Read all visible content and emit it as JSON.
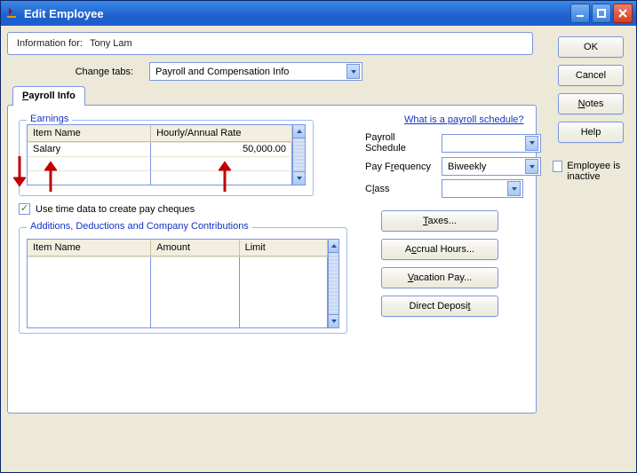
{
  "title": "Edit Employee",
  "info_label": "Information for:",
  "info_name": "Tony Lam",
  "change_tabs_label": "Change tabs:",
  "tab_selector_value": "Payroll and Compensation Info",
  "active_tab": "Payroll Info",
  "earnings": {
    "legend": "Earnings",
    "col_name": "Item Name",
    "col_rate": "Hourly/Annual Rate",
    "rows": [
      {
        "name": "Salary",
        "rate": "50,000.00"
      }
    ]
  },
  "use_time_data_label": "Use time data to create pay cheques",
  "use_time_data_checked": true,
  "link_text": "What is a payroll schedule?",
  "fields": {
    "payroll_schedule_label": "Payroll Schedule",
    "payroll_schedule_value": "",
    "pay_frequency_label": "Pay Frequency",
    "pay_frequency_value": "Biweekly",
    "class_label": "Class",
    "class_value": ""
  },
  "buttons": {
    "taxes": "Taxes...",
    "accrual": "Accrual Hours...",
    "vacation": "Vacation Pay...",
    "deposit": "Direct Deposit"
  },
  "contrib": {
    "legend": "Additions, Deductions and Company Contributions",
    "col_name": "Item Name",
    "col_amount": "Amount",
    "col_limit": "Limit"
  },
  "side": {
    "ok": "OK",
    "cancel": "Cancel",
    "notes": "Notes",
    "help": "Help"
  },
  "inactive_label": "Employee is inactive"
}
